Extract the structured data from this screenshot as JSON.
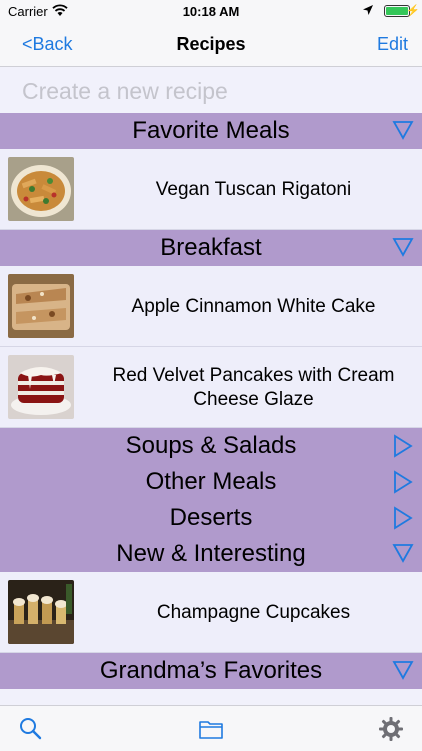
{
  "status_bar": {
    "carrier": "Carrier",
    "time": "10:18 AM"
  },
  "nav": {
    "back_label": "<Back",
    "title": "Recipes",
    "edit_label": "Edit"
  },
  "new_recipe": {
    "placeholder": "Create a new recipe"
  },
  "sections": [
    {
      "name": "Favorite Meals",
      "expanded": true,
      "recipes": [
        "Vegan Tuscan Rigatoni"
      ]
    },
    {
      "name": "Breakfast",
      "expanded": true,
      "recipes": [
        "Apple Cinnamon White Cake",
        "Red Velvet Pancakes with Cream Cheese Glaze"
      ]
    },
    {
      "name": "Soups & Salads",
      "expanded": false,
      "recipes": []
    },
    {
      "name": "Other Meals",
      "expanded": false,
      "recipes": []
    },
    {
      "name": "Deserts",
      "expanded": false,
      "recipes": []
    },
    {
      "name": "New & Interesting",
      "expanded": true,
      "recipes": [
        "Champagne Cupcakes"
      ]
    },
    {
      "name": "Grandma’s Favorites",
      "expanded": true,
      "recipes": []
    }
  ],
  "tab_bar": {
    "icons": [
      "search-icon",
      "folder-icon",
      "gear-icon"
    ]
  },
  "colors": {
    "accent": "#1f7ae0",
    "section_header": "#b09acc",
    "row_background": "#eeeefa",
    "battery": "#34c759"
  }
}
